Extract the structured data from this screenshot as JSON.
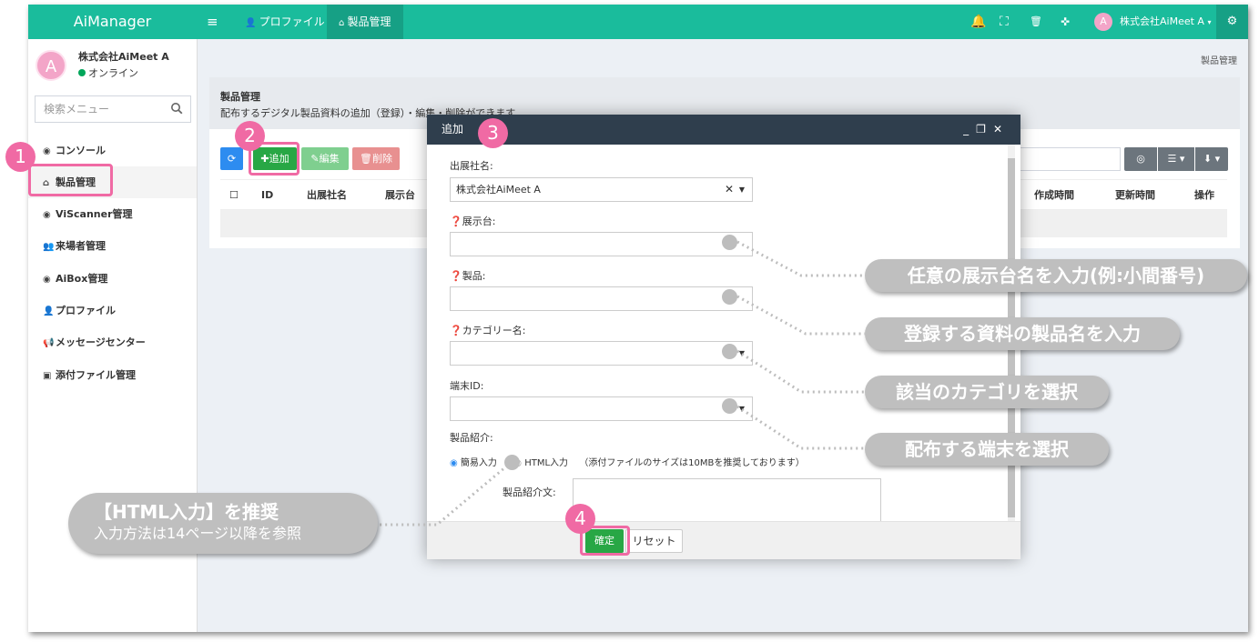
{
  "app": {
    "title": "AiManager"
  },
  "topbar": {
    "menu_icon": "≡",
    "nav_profile": "プロファイル",
    "nav_products": "製品管理",
    "user_initial": "A",
    "user_name": "株式会社AiMeet A"
  },
  "sidebar": {
    "avatar_initial": "A",
    "company": "株式会社AiMeet A",
    "status": "オンライン",
    "search_placeholder": "検索メニュー",
    "items": [
      {
        "label": "コンソール"
      },
      {
        "label": "製品管理"
      },
      {
        "label": "ViScanner管理"
      },
      {
        "label": "来場者管理"
      },
      {
        "label": "AiBox管理"
      },
      {
        "label": "プロファイル"
      },
      {
        "label": "メッセージセンター"
      },
      {
        "label": "添付ファイル管理"
      }
    ]
  },
  "main": {
    "breadcrumb": "製品管理",
    "panel_title": "製品管理",
    "panel_desc": "配布するデジタル製品資料の追加（登録）・編集・削除ができます",
    "btn_add": "追加",
    "btn_edit": "編集",
    "btn_delete": "削除",
    "columns": [
      "ID",
      "出展社名",
      "展示台",
      "作成時間",
      "更新時間",
      "操作"
    ]
  },
  "modal": {
    "title": "追加",
    "exhibitor_label": "出展社名:",
    "exhibitor_value": "株式会社AiMeet A",
    "booth_label": "❓展示台:",
    "product_label": "❓製品:",
    "category_label": "❓カテゴリー名:",
    "device_label": "端末ID:",
    "intro_label": "製品紹介:",
    "radio_simple": "簡易入力",
    "radio_html": "HTML入力",
    "attach_note": "（添付ファイルのサイズは10MBを推奨しております）",
    "intro_text_label": "製品紹介文:",
    "btn_confirm": "確定",
    "btn_reset": "リセット"
  },
  "annotations": {
    "markers": [
      "1",
      "2",
      "3",
      "4"
    ],
    "callout_booth": "任意の展示台名を入力(例:小間番号)",
    "callout_product": "登録する資料の製品名を入力",
    "callout_category": "該当のカテゴリを選択",
    "callout_device": "配布する端末を選択",
    "callout_html_title": "【HTML入力】を推奨",
    "callout_html_sub": "入力方法は14ページ以降を参照"
  },
  "colors": {
    "primary": "#1abc9c",
    "modal_header": "#2f3e4d",
    "marker": "#f06aa4",
    "callout": "#bfbfbf"
  }
}
